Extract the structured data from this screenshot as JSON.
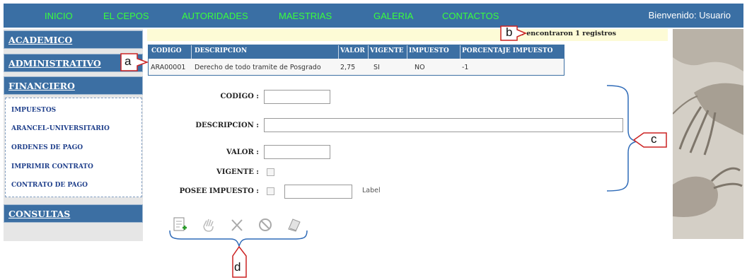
{
  "nav": {
    "items": [
      "INICIO",
      "EL CEPOS",
      "AUTORIDADES",
      "MAESTRIAS",
      "GALERIA",
      "CONTACTOS"
    ],
    "welcome": "Bienvenido: Usuario"
  },
  "sidebar": {
    "menus": [
      "ACADEMICO",
      "ADMINISTRATIVO",
      "FINANCIERO",
      "CONSULTAS"
    ],
    "financiero_items": [
      "IMPUESTOS",
      "ARANCEL-UNIVERSITARIO",
      "ORDENES DE PAGO",
      "IMPRIMIR CONTRATO",
      "CONTRATO DE PAGO"
    ]
  },
  "message": "Se encontraron 1 registros",
  "table": {
    "headers": [
      "CODIGO",
      "DESCRIPCION",
      "VALOR",
      "VIGENTE",
      "IMPUESTO",
      "PORCENTAJE IMPUESTO"
    ],
    "rows": [
      [
        "ARA00001",
        "Derecho de todo tramite de Posgrado",
        "2,75",
        "SI",
        "NO",
        "-1"
      ]
    ]
  },
  "form": {
    "codigo_label": "CODIGO :",
    "descripcion_label": "DESCRIPCION :",
    "valor_label": "VALOR :",
    "vigente_label": "VIGENTE :",
    "impuesto_label": "POSEE IMPUESTO :",
    "extra_label": "Label",
    "codigo_value": "",
    "descripcion_value": "",
    "valor_value": "",
    "impuesto_value": ""
  },
  "toolbar": {
    "icons": [
      "new-document-icon",
      "edit-hand-icon",
      "delete-x-icon",
      "cancel-circle-icon",
      "save-document-icon"
    ]
  },
  "callouts": {
    "a": "a",
    "b": "b",
    "c": "c",
    "d": "d"
  },
  "colors": {
    "nav_bg": "#3a6fa4",
    "nav_link": "#39ff3c",
    "menu_bg": "#3c6fa3",
    "callout_border": "#cc2222",
    "message_bg": "#fdfbd6"
  }
}
